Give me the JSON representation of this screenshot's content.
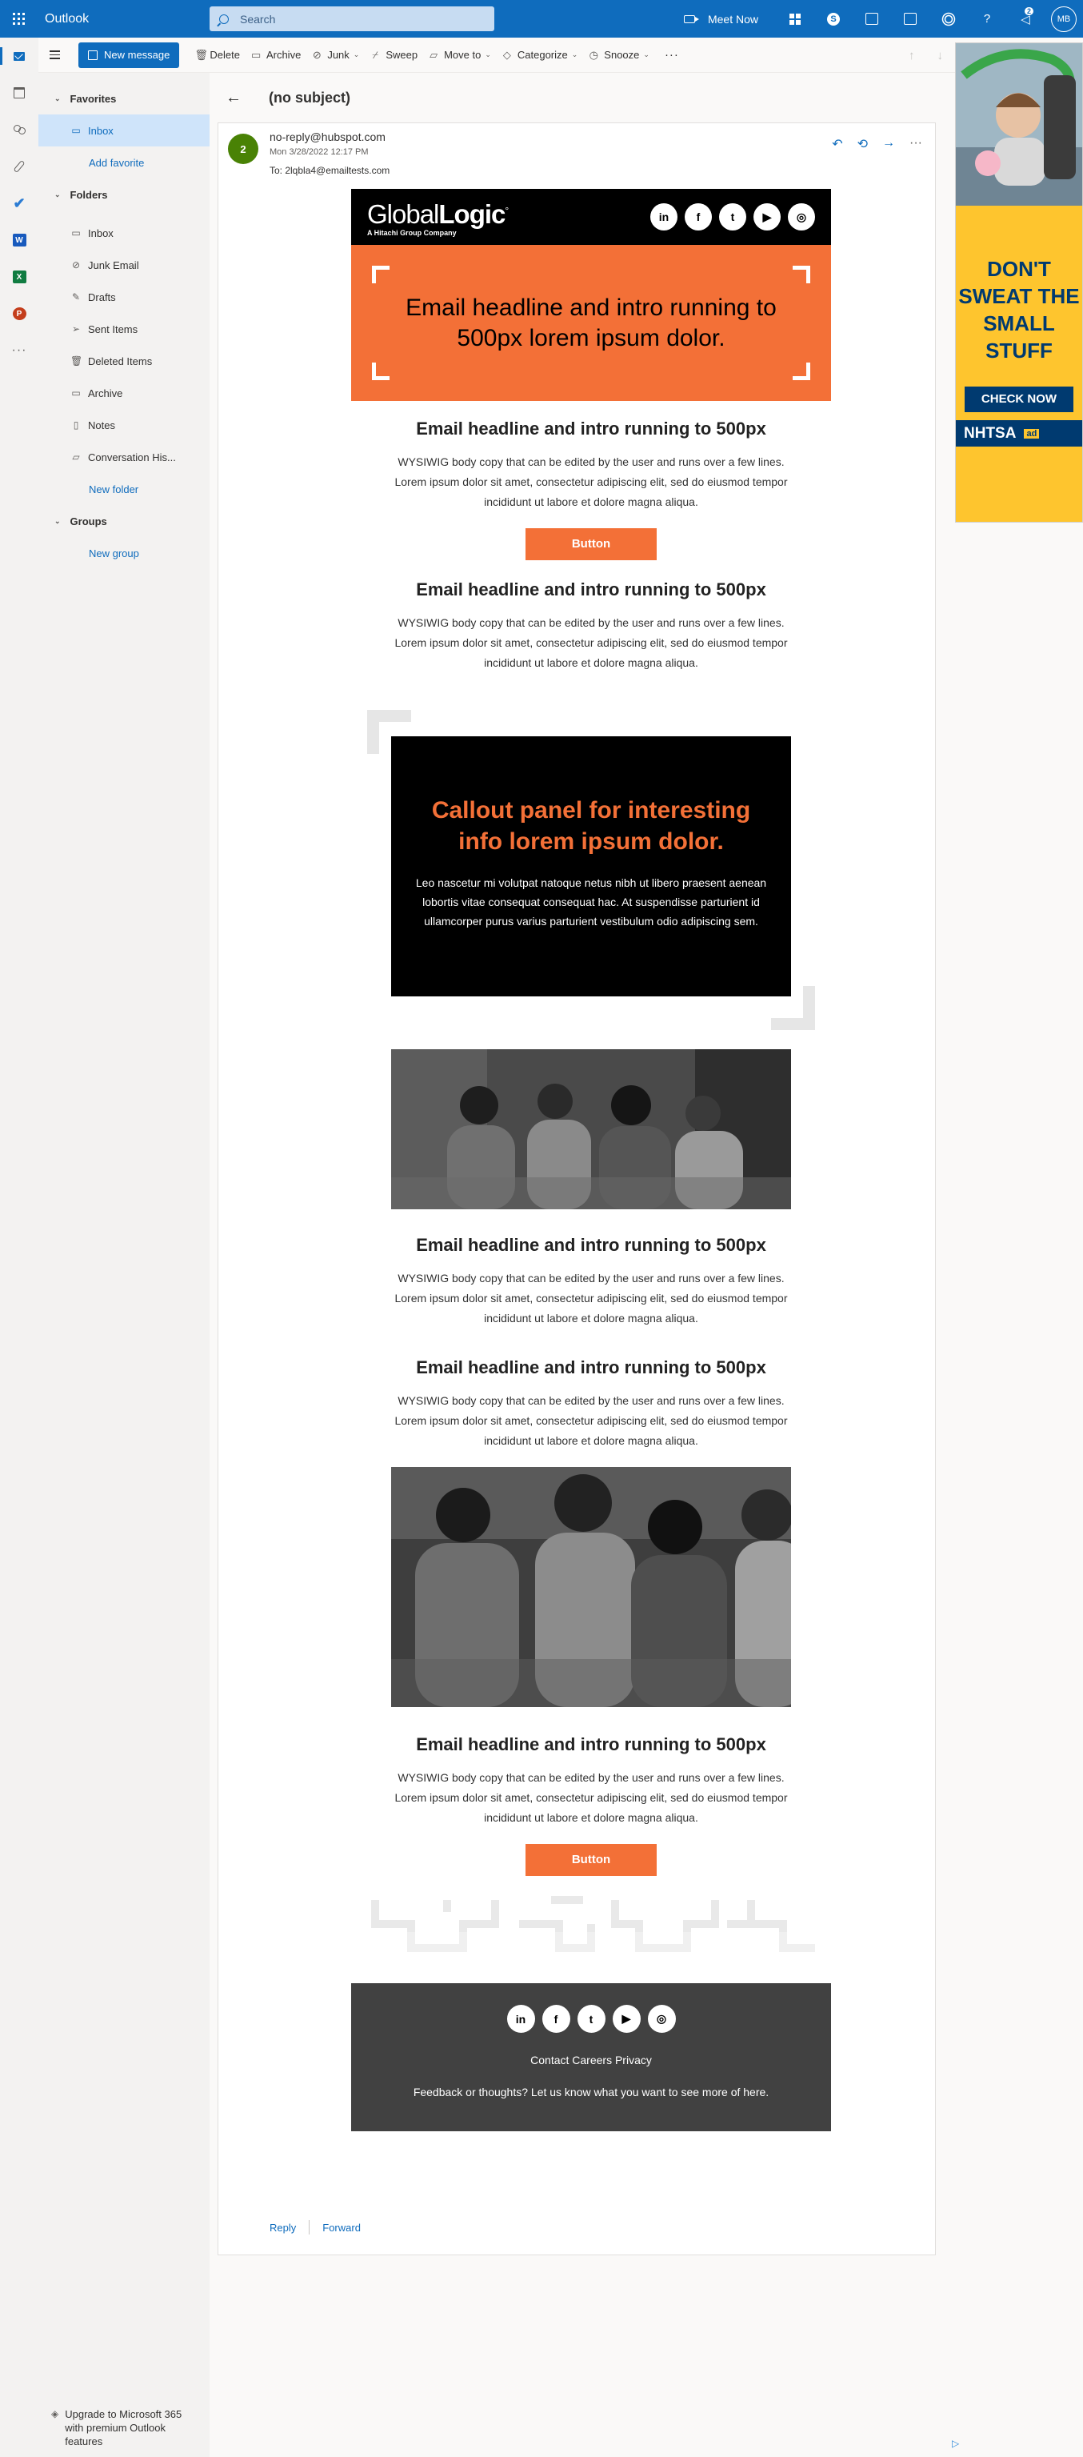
{
  "app": {
    "name": "Outlook"
  },
  "search": {
    "placeholder": "Search"
  },
  "topbar": {
    "meet_now": "Meet Now",
    "notification_count": "2",
    "avatar_initials": "MB"
  },
  "toolbar": {
    "new_message": "New message",
    "delete": "Delete",
    "archive": "Archive",
    "junk": "Junk",
    "sweep": "Sweep",
    "move_to": "Move to",
    "categorize": "Categorize",
    "snooze": "Snooze",
    "more": "···"
  },
  "sidebar": {
    "favorites_label": "Favorites",
    "favorites": [
      {
        "label": "Inbox"
      }
    ],
    "add_favorite": "Add favorite",
    "folders_label": "Folders",
    "folders": [
      {
        "label": "Inbox"
      },
      {
        "label": "Junk Email"
      },
      {
        "label": "Drafts"
      },
      {
        "label": "Sent Items"
      },
      {
        "label": "Deleted Items"
      },
      {
        "label": "Archive"
      },
      {
        "label": "Notes"
      },
      {
        "label": "Conversation His..."
      }
    ],
    "new_folder": "New folder",
    "groups_label": "Groups",
    "new_group": "New group",
    "upgrade": "Upgrade to Microsoft 365 with premium Outlook features"
  },
  "message": {
    "subject": "(no subject)",
    "sender_initial": "2",
    "sender": "no-reply@hubspot.com",
    "sent": "Mon 3/28/2022 12:17 PM",
    "to": "To: 2lqbla4@emailtests.com",
    "reply": "Reply",
    "forward": "Forward"
  },
  "email": {
    "logo_light": "Global",
    "logo_bold": "Logic",
    "logo_tm": "°",
    "logo_tagline": "A Hitachi Group Company",
    "social": [
      "in",
      "f",
      "t",
      "▶",
      "◎"
    ],
    "hero_text": "Email headline and intro running to 500px lorem ipsum dolor.",
    "headline": "Email headline and intro running to 500px",
    "body": "WYSIWIG body copy that can be edited by the user and runs over a few lines. Lorem ipsum dolor sit amet, consectetur adipiscing elit, sed do eiusmod tempor incididunt ut labore et dolore magna aliqua.",
    "button": "Button",
    "callout_title": "Callout panel for interesting info lorem ipsum dolor.",
    "callout_body": "Leo nascetur mi volutpat natoque netus nibh ut libero praesent aenean lobortis vitae consequat consequat hac. At suspendisse parturient id ullamcorper purus varius parturient vestibulum odio adipiscing sem.",
    "footer_links": "Contact Careers Privacy",
    "footer_feedback": "Feedback or thoughts? Let us know what you want to see more of here."
  },
  "ad": {
    "headline": "DON'T SWEAT THE SMALL STUFF",
    "cta": "CHECK NOW",
    "brand": "NHTSA",
    "badge": "ad",
    "colors": {
      "bg": "#fec52e",
      "text": "#003a70"
    }
  },
  "colors": {
    "accent": "#0f6cbd",
    "brand_orange": "#f37037",
    "avatar_green": "#498205"
  }
}
